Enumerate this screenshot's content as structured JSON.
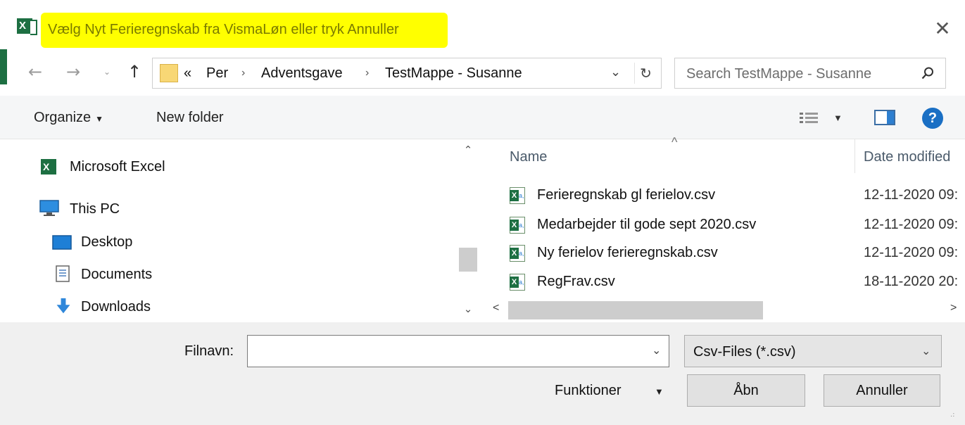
{
  "window": {
    "title": "Vælg Nyt Ferieregnskab fra VismaLøn eller tryk Annuller",
    "close_glyph": "✕",
    "highlight_color": "#ffff00"
  },
  "nav": {
    "back_glyph": "←",
    "forward_glyph": "→",
    "recent_glyph": "⌄",
    "up_glyph": "↑"
  },
  "address": {
    "overflow": "«",
    "crumbs": [
      "Per",
      "Adventsgave",
      "TestMappe - Susanne"
    ],
    "separator": "›",
    "dropdown_glyph": "⌄",
    "refresh_glyph": "↻"
  },
  "search": {
    "placeholder": "Search TestMappe - Susanne"
  },
  "toolbar": {
    "organize_label": "Organize",
    "organize_caret": "▼",
    "new_folder_label": "New folder",
    "view_caret": "▼",
    "help_label": "?"
  },
  "navpane": {
    "scroll_up": "⌃",
    "scroll_down": "⌄",
    "items": [
      {
        "label": "Microsoft Excel",
        "icon": "excel-icon"
      },
      {
        "label": "This PC",
        "icon": "computer-icon"
      },
      {
        "label": "Desktop",
        "icon": "desktop-icon"
      },
      {
        "label": "Documents",
        "icon": "documents-icon"
      },
      {
        "label": "Downloads",
        "icon": "downloads-icon"
      }
    ]
  },
  "filelist": {
    "sort_caret": "^",
    "columns": {
      "name": "Name",
      "date": "Date modified"
    },
    "files": [
      {
        "name": "Ferieregnskab gl ferielov.csv",
        "date": "12-11-2020 09:"
      },
      {
        "name": "Medarbejder til gode sept 2020.csv",
        "date": "12-11-2020 09:"
      },
      {
        "name": "Ny ferielov ferieregnskab.csv",
        "date": "12-11-2020 09:"
      },
      {
        "name": "RegFrav.csv",
        "date": "18-11-2020 20:"
      }
    ],
    "scroll_left": "<",
    "scroll_right": ">"
  },
  "footer": {
    "filename_label": "Filnavn:",
    "filename_value": "",
    "filename_drop": "⌄",
    "filetype_value": "Csv-Files (*.csv)",
    "filetype_drop": "⌄",
    "tools_label": "Funktioner",
    "tools_caret": "▼",
    "open_label": "Åbn",
    "cancel_label": "Annuller",
    "grip": ".:"
  },
  "colors": {
    "excel_green": "#1d6f42",
    "help_blue": "#1a6fc4",
    "folder_yellow": "#f8d775"
  }
}
